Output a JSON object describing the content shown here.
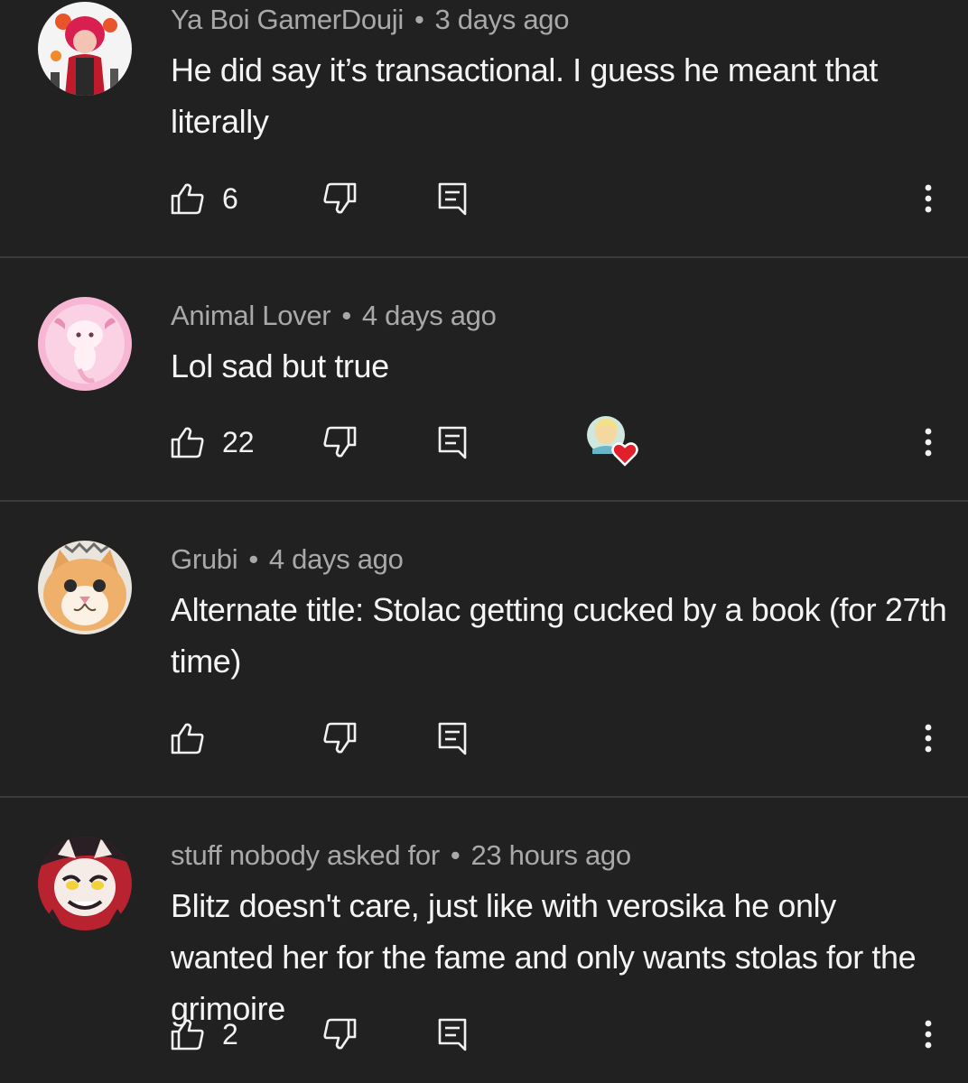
{
  "comments": [
    {
      "author": "Ya Boi GamerDouji",
      "time": "3 days ago",
      "text": "He did say it’s transactional. I guess he meant that literally",
      "likes": "6",
      "hearted": false
    },
    {
      "author": "Animal Lover",
      "time": "4 days ago",
      "text": "Lol sad but true",
      "likes": "22",
      "hearted": true
    },
    {
      "author": "Grubi",
      "time": "4 days ago",
      "text": "Alternate title: Stolac getting cucked by a book (for 27th time)",
      "likes": "",
      "hearted": false
    },
    {
      "author": "stuff nobody asked for",
      "time": "23 hours ago",
      "text": "Blitz doesn't care, just like with verosika he only wanted her for the fame and only wants stolas for the grimoire",
      "likes": "2",
      "hearted": false
    }
  ],
  "separator": "•",
  "icons": {
    "like": "thumbs-up-icon",
    "dislike": "thumbs-down-icon",
    "reply": "reply-icon",
    "more": "more-vert-icon",
    "heart": "creator-heart-icon"
  },
  "colors": {
    "background": "#212121",
    "divider": "#3b3b3b",
    "meta_text": "#a9a9a9",
    "body_text": "#f4f4f4",
    "heart": "#e0202a"
  }
}
